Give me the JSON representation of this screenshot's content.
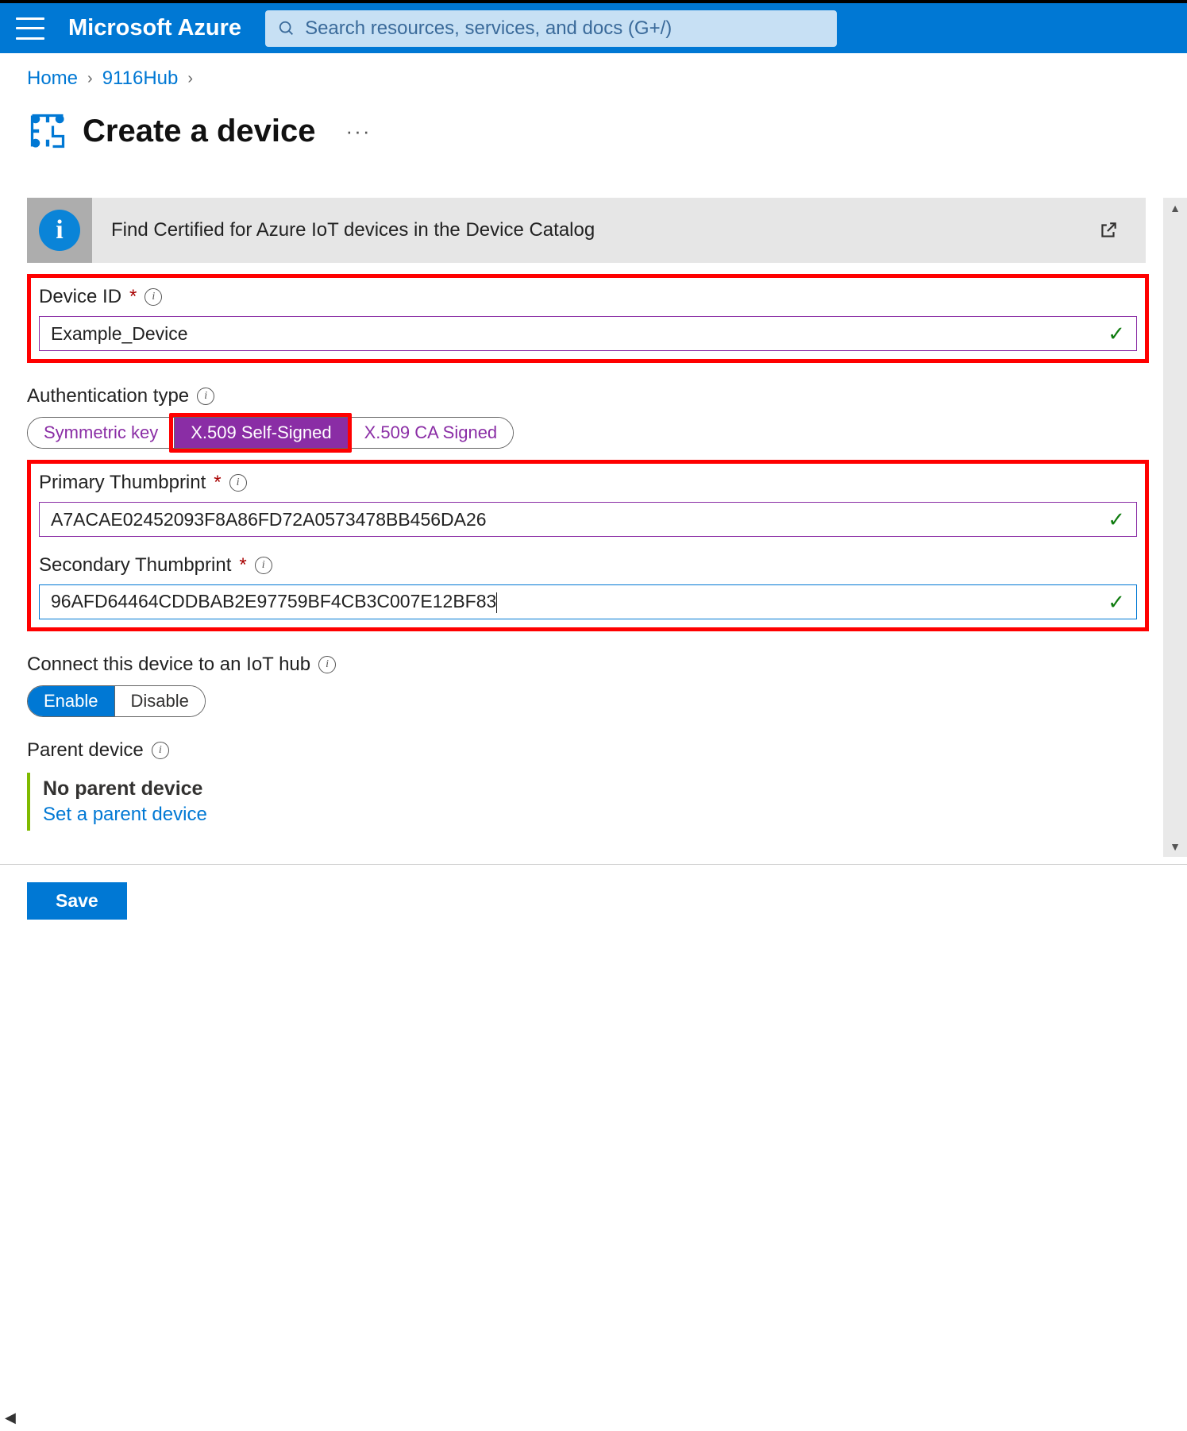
{
  "header": {
    "brand": "Microsoft Azure",
    "search_placeholder": "Search resources, services, and docs (G+/)"
  },
  "breadcrumb": {
    "home": "Home",
    "hub": "9116Hub"
  },
  "page": {
    "title": "Create a device"
  },
  "banner": {
    "text": "Find Certified for Azure IoT devices in the Device Catalog"
  },
  "form": {
    "device_id_label": "Device ID",
    "device_id_value": "Example_Device",
    "auth_label": "Authentication type",
    "auth_options": {
      "symmetric": "Symmetric key",
      "self_signed": "X.509 Self-Signed",
      "ca_signed": "X.509 CA Signed"
    },
    "primary_label": "Primary Thumbprint",
    "primary_value": "A7ACAE02452093F8A86FD72A0573478BB456DA26",
    "secondary_label": "Secondary Thumbprint",
    "secondary_value": "96AFD64464CDDBAB2E97759BF4CB3C007E12BF83",
    "connect_label": "Connect this device to an IoT hub",
    "connect_options": {
      "enable": "Enable",
      "disable": "Disable"
    },
    "parent_label": "Parent device",
    "parent_value": "No parent device",
    "parent_link": "Set a parent device"
  },
  "actions": {
    "save": "Save"
  }
}
